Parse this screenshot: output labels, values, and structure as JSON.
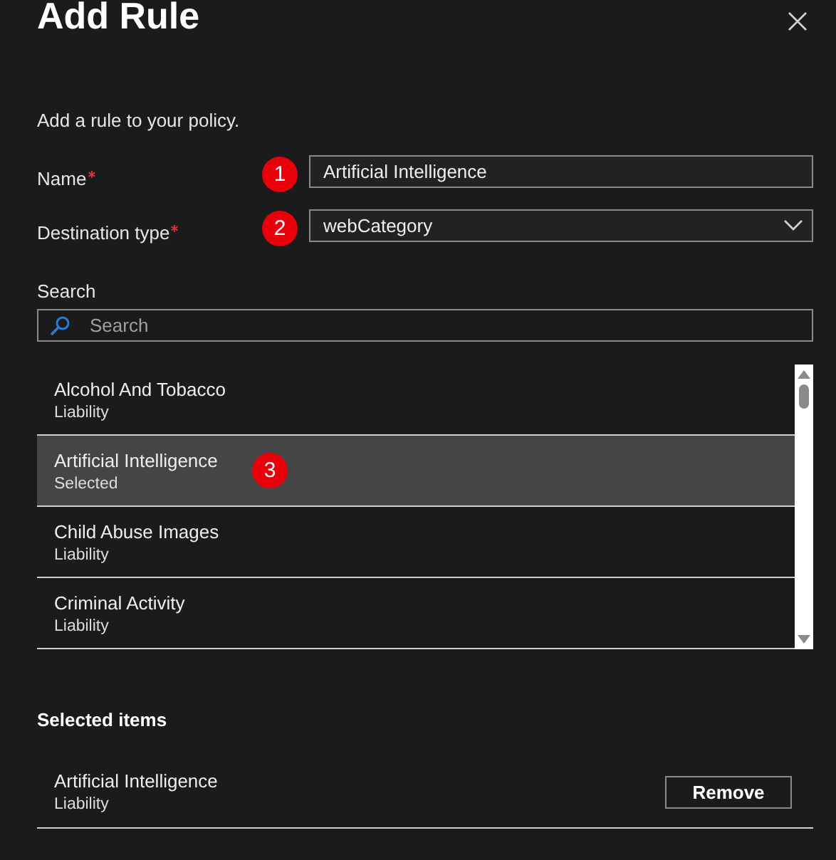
{
  "dialog": {
    "title": "Add Rule",
    "description": "Add a rule to your policy.",
    "fields": [
      {
        "kind": "text",
        "label": "Name",
        "required": true,
        "value": "Artificial Intelligence",
        "marker": "1"
      },
      {
        "kind": "dropdown",
        "label": "Destination type",
        "required": true,
        "value": "webCategory",
        "marker": "2"
      }
    ],
    "search": {
      "label": "Search",
      "placeholder": "Search"
    },
    "categories": [
      {
        "name": "Alcohol And Tobacco",
        "detail": "Liability",
        "selected": false
      },
      {
        "name": "Artificial Intelligence",
        "detail": "Selected",
        "selected": true,
        "marker": "3"
      },
      {
        "name": "Child Abuse Images",
        "detail": "Liability",
        "selected": false
      },
      {
        "name": "Criminal Activity",
        "detail": "Liability",
        "selected": false
      }
    ],
    "selected_items": {
      "heading": "Selected items",
      "items": [
        {
          "name": "Artificial Intelligence",
          "detail": "Liability",
          "button": "Remove"
        }
      ]
    }
  }
}
